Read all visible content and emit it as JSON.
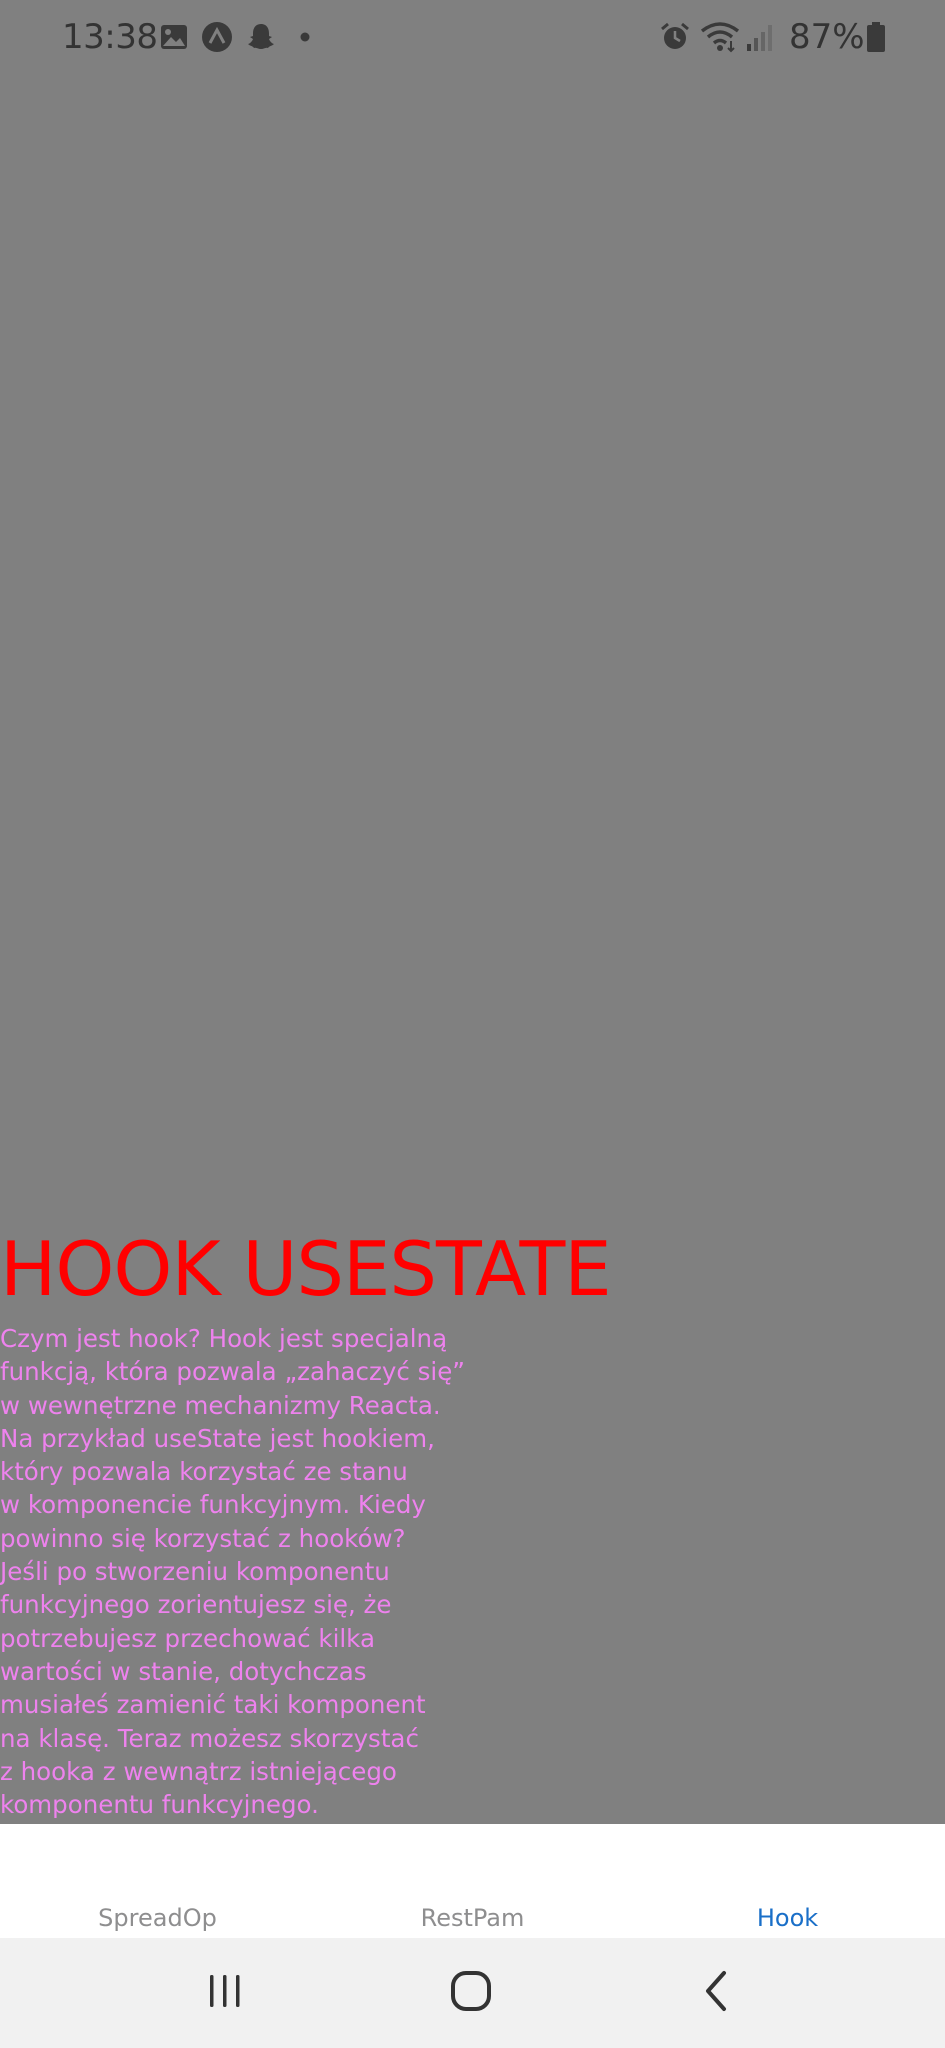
{
  "status_bar": {
    "time": "13:38",
    "battery_percent": "87%",
    "icons": [
      "image-icon",
      "app-icon",
      "snapchat-icon",
      "dot-icon",
      "alarm-icon",
      "wifi-icon",
      "signal-icon",
      "battery-icon"
    ]
  },
  "content": {
    "title": "HOOK USESTATE",
    "body": "Czym jest hook? Hook jest specjalną\nfunkcją, która pozwala „zahaczyć się”\nw wewnętrzne mechanizmy Reacta.\nNa przykład useState jest hookiem,\nktóry pozwala korzystać ze stanu\nw komponencie funkcyjnym. Kiedy\npowinno się korzystać z hooków?\nJeśli po stworzeniu komponentu\nfunkcyjnego zorientujesz się, że\npotrzebujesz przechować kilka\nwartości w stanie, dotychczas\nmusiałeś zamienić taki komponent\nna klasę. Teraz możesz skorzystać\nz hooka z wewnątrz istniejącego\nkomponentu funkcyjnego.",
    "title_color": "#ff0000",
    "body_color": "#ee82ee",
    "background_color": "#808080"
  },
  "tabs": [
    {
      "label": "SpreadOp",
      "active": false
    },
    {
      "label": "RestPam",
      "active": false
    },
    {
      "label": "Hook",
      "active": true
    }
  ],
  "colors": {
    "tab_active": "#1a6fc8",
    "tab_inactive": "#8e8e8f"
  },
  "nav_bar": {
    "buttons": [
      "recent-apps-icon",
      "home-icon",
      "back-icon"
    ]
  }
}
